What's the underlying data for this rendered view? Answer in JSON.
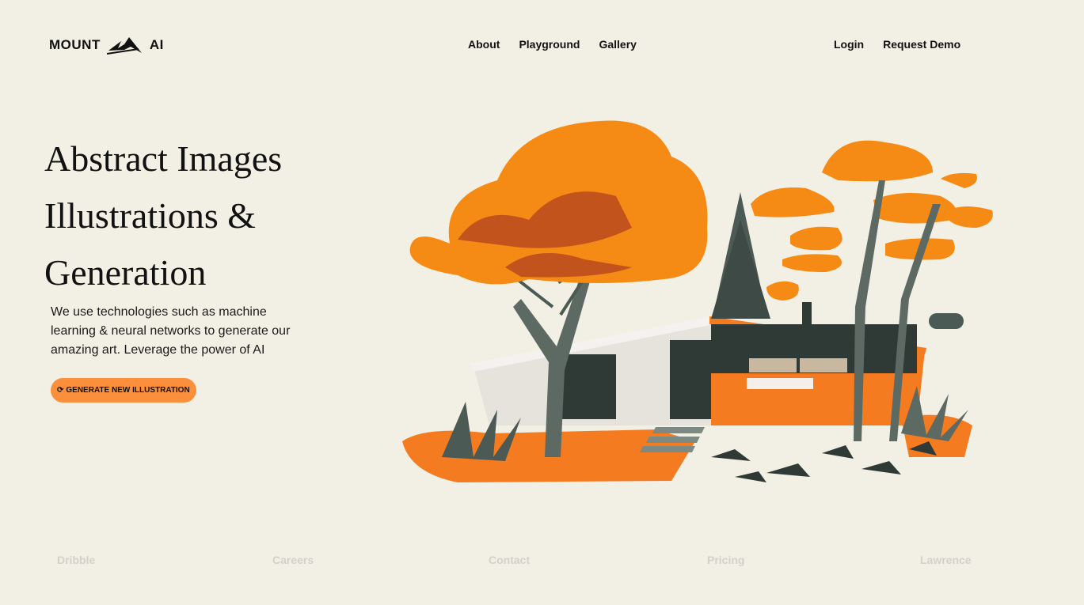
{
  "brand": {
    "name_left": "MOUNT",
    "name_right": "AI",
    "logo_icon": "mountain-icon"
  },
  "nav": {
    "center": [
      "About",
      "Playground",
      "Gallery"
    ],
    "right": [
      "Login",
      "Request Demo"
    ]
  },
  "hero": {
    "title_lines": [
      "Abstract Images",
      "Illustrations &",
      "Generation"
    ],
    "description": "We use technologies such as machine learning & neural networks to generate our amazing art. Leverage the power of AI",
    "cta_label": "GENERATE NEW ILLUSTRATION",
    "cta_icon": "refresh-icon"
  },
  "footer": {
    "links": [
      "Dribble",
      "Careers",
      "Contact",
      "Pricing",
      "Lawrence"
    ]
  },
  "colors": {
    "background": "#f2efe4",
    "accent": "#fb8f3c",
    "orange": "#f47b20",
    "dark": "#2f3a36"
  }
}
